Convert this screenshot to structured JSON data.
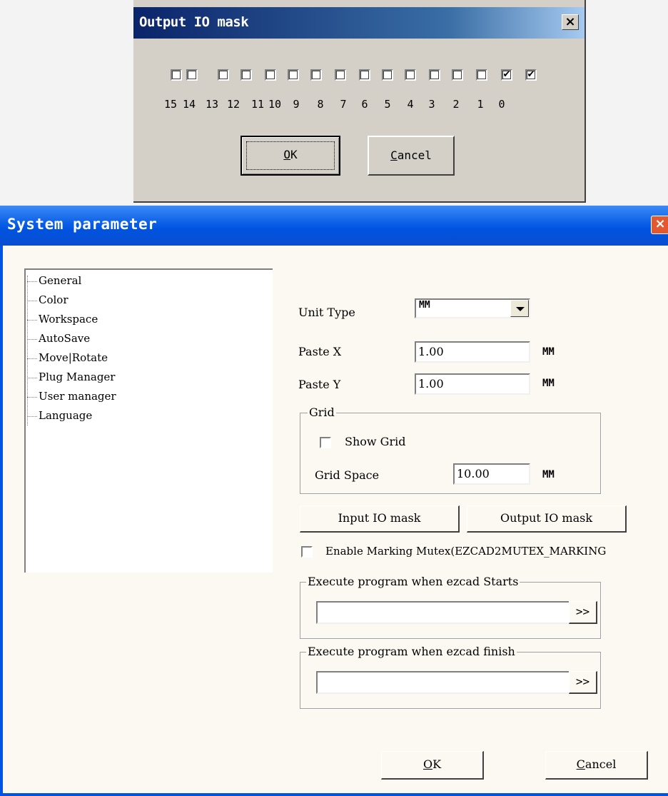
{
  "io_dialog": {
    "title": "Output IO mask",
    "close_glyph": "×",
    "bits": [
      {
        "label": "15",
        "checked": false
      },
      {
        "label": "14",
        "checked": false
      },
      {
        "label": "13",
        "checked": false
      },
      {
        "label": "12",
        "checked": false
      },
      {
        "label": "11",
        "checked": false
      },
      {
        "label": "10",
        "checked": false
      },
      {
        "label": "9",
        "checked": false
      },
      {
        "label": "8",
        "checked": false
      },
      {
        "label": "7",
        "checked": false
      },
      {
        "label": "6",
        "checked": false
      },
      {
        "label": "5",
        "checked": false
      },
      {
        "label": "4",
        "checked": false
      },
      {
        "label": "3",
        "checked": false
      },
      {
        "label": "2",
        "checked": false
      },
      {
        "label": "1",
        "checked": true
      },
      {
        "label": "0",
        "checked": true
      }
    ],
    "ok_mnemonic": "O",
    "ok_rest": "K",
    "cancel_mnemonic": "C",
    "cancel_rest": "ancel"
  },
  "sys_dialog": {
    "title": "System parameter",
    "close_glyph": "×",
    "tree": [
      "General",
      "Color",
      "Workspace",
      "AutoSave",
      "Move|Rotate",
      "Plug Manager",
      "User manager",
      "Language"
    ],
    "unit_type_label": "Unit Type",
    "unit_type_value": "MM",
    "paste_x_label": "Paste X",
    "paste_x_value": "1.00",
    "paste_x_unit": "MM",
    "paste_y_label": "Paste Y",
    "paste_y_value": "1.00",
    "paste_y_unit": "MM",
    "grid_group": "Grid",
    "show_grid_label": "Show Grid",
    "show_grid_checked": false,
    "grid_space_label": "Grid Space",
    "grid_space_value": "10.00",
    "grid_space_unit": "MM",
    "input_io_button": "Input IO mask",
    "output_io_button": "Output IO mask",
    "mutex_label": "Enable Marking Mutex(EZCAD2MUTEX_MARKING",
    "mutex_checked": false,
    "exec_start_group": "Execute program when ezcad Starts",
    "exec_start_value": "",
    "exec_finish_group": "Execute program when ezcad finish",
    "exec_finish_value": "",
    "browse_label": ">>",
    "ok_mnemonic": "O",
    "ok_rest": "K",
    "cancel_mnemonic": "C",
    "cancel_rest": "ancel"
  }
}
